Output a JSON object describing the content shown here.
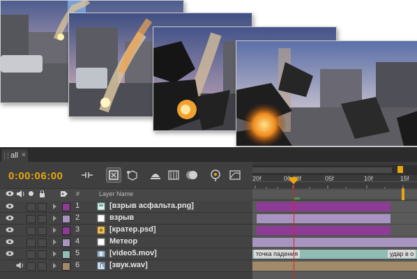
{
  "panel": {
    "tab_label": "all",
    "tab_close": "×",
    "timecode": "0:00:06:00",
    "header": {
      "layer_name": "Layer Name",
      "number_sign": "#"
    },
    "ruler": {
      "ticks": [
        "20f",
        "06:00f",
        "05f",
        "10f",
        "15f"
      ]
    },
    "layers": [
      {
        "number": "1",
        "name": "[взрыв асфальта.png]",
        "label_color": "#8e3a97",
        "file_icon": "image-sequence-icon"
      },
      {
        "number": "2",
        "name": "взрыв",
        "label_color": "#a794c0",
        "file_icon": "solid-white-icon"
      },
      {
        "number": "3",
        "name": "[кратер.psd]",
        "label_color": "#8e3a97",
        "file_icon": "photoshop-file-icon"
      },
      {
        "number": "4",
        "name": "Метеор",
        "label_color": "#a794c0",
        "file_icon": "solid-white-icon"
      },
      {
        "number": "5",
        "name": "[video5.mov]",
        "label_color": "#8fbcb3",
        "file_icon": "video-file-icon"
      },
      {
        "number": "6",
        "name": "[звук.wav]",
        "label_color": "#a08a6a",
        "file_icon": "audio-file-icon"
      }
    ],
    "markers": {
      "impact_point": "точка падения",
      "strike": "удар в о"
    }
  },
  "colors": {
    "timecode": "#e9a60e",
    "playhead": "#e02020",
    "layer_purple": "#8e3a97",
    "layer_lavender": "#a794c0",
    "layer_teal": "#8fbcb3",
    "layer_tan": "#a08a6a"
  }
}
